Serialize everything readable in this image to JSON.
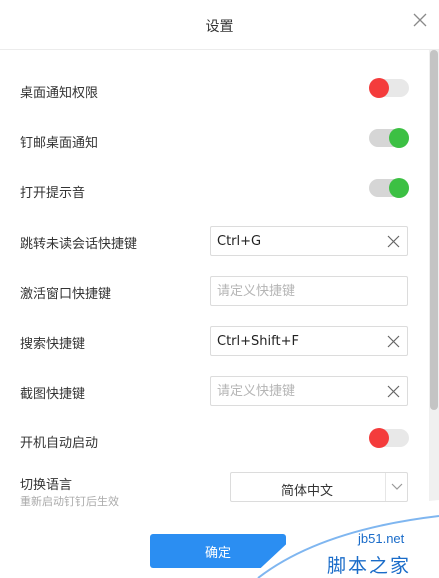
{
  "window": {
    "title": "设置"
  },
  "settings": {
    "desktop_notify": {
      "label": "桌面通知权限",
      "state": "off"
    },
    "pin_notify": {
      "label": "钉邮桌面通知",
      "state": "on"
    },
    "sound": {
      "label": "打开提示音",
      "state": "on"
    },
    "unread_shortcut": {
      "label": "跳转未读会话快捷键",
      "value": "Ctrl+G",
      "placeholder": ""
    },
    "activate_shortcut": {
      "label": "激活窗口快捷键",
      "value": "",
      "placeholder": "请定义快捷键"
    },
    "search_shortcut": {
      "label": "搜索快捷键",
      "value": "Ctrl+Shift+F",
      "placeholder": ""
    },
    "screenshot_shortcut": {
      "label": "截图快捷键",
      "value": "",
      "placeholder": "请定义快捷键"
    },
    "autostart": {
      "label": "开机自动启动",
      "state": "off"
    },
    "language": {
      "label": "切换语言",
      "hint": "重新启动钉钉后生效",
      "selected": "简体中文"
    }
  },
  "footer": {
    "confirm_label": "确定"
  },
  "watermark": {
    "site": "jb51.net",
    "text": "脚本之家"
  },
  "colors": {
    "primary": "#2b8ef2",
    "toggle_on": "#3cc043",
    "toggle_off": "#f43c3c"
  },
  "icons": {
    "close": "close-icon",
    "clear": "clear-icon",
    "caret": "chevron-down-icon"
  }
}
